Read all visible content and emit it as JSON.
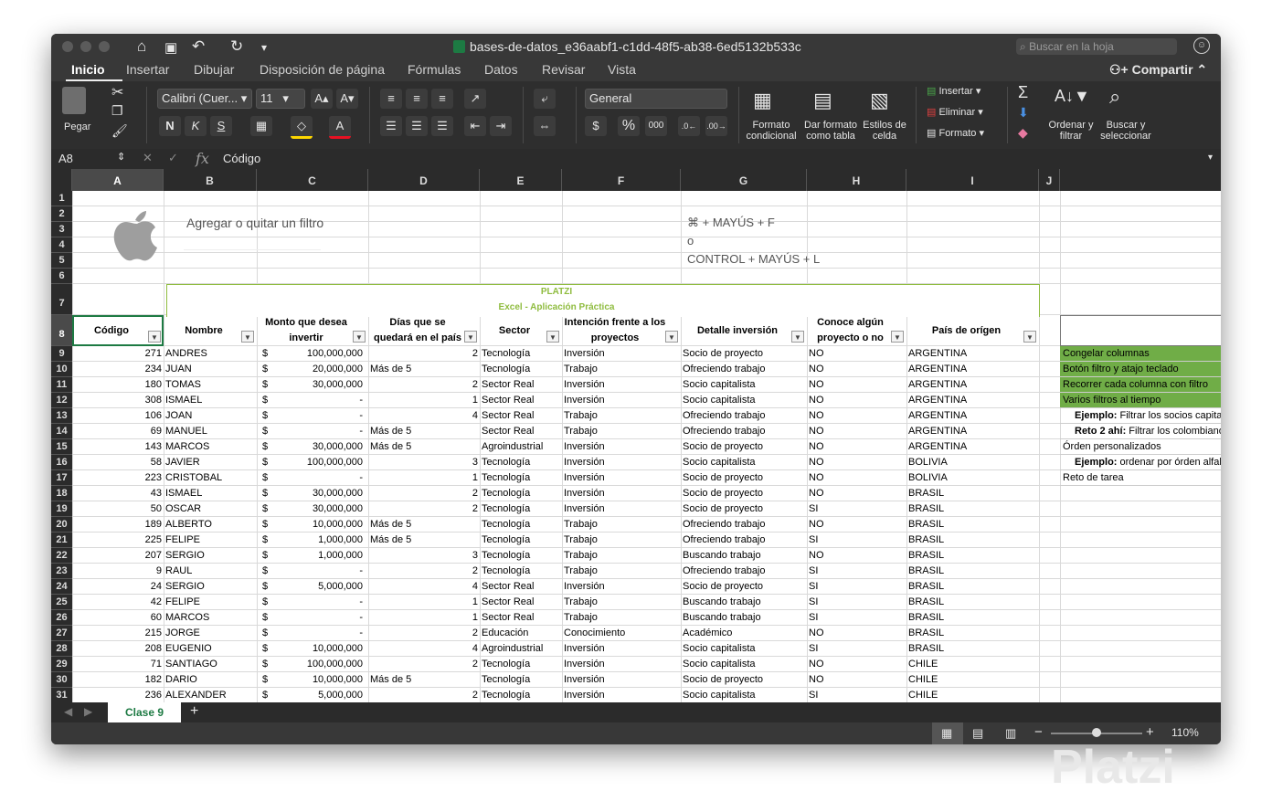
{
  "window": {
    "title": "bases-de-datos_e36aabf1-c1dd-48f5-ab38-6ed5132b533c",
    "search_placeholder": "Buscar en la hoja",
    "share_label": "Compartir"
  },
  "tabs": [
    "Inicio",
    "Insertar",
    "Dibujar",
    "Disposición de página",
    "Fórmulas",
    "Datos",
    "Revisar",
    "Vista"
  ],
  "ribbon": {
    "paste_label": "Pegar",
    "font_name": "Calibri (Cuer...",
    "font_size": "11",
    "number_format": "General",
    "cond_format_label": "Formato condicional",
    "table_format_label": "Dar formato como tabla",
    "cell_styles_label": "Estilos de celda",
    "insert_label": "Insertar",
    "delete_label": "Eliminar",
    "format_label": "Formato",
    "sort_filter_label": "Ordenar y filtrar",
    "find_select_label": "Buscar y seleccionar"
  },
  "formula_bar": {
    "name_box": "A8",
    "fx": "fx",
    "value": "Código"
  },
  "columns": [
    "A",
    "B",
    "C",
    "D",
    "E",
    "F",
    "G",
    "H",
    "I",
    "J"
  ],
  "info_panel": {
    "text": "Agregar o quitar un filtro",
    "shortcut_mac": "⌘ + MAYÚS + F",
    "or": "o",
    "shortcut_win": "CONTROL + MAYÚS + L"
  },
  "banner": {
    "line1": "PLATZI",
    "line2": "Excel - Aplicación Práctica"
  },
  "headers": [
    "Código",
    "Nombre",
    "Monto que desea invertir",
    "Días que se quedará en el país",
    "Sector",
    "Intención frente a los proyectos",
    "Detalle inversión",
    "Conoce algún proyecto o no",
    "País de orígen"
  ],
  "rows": [
    {
      "n": "9",
      "codigo": "271",
      "nombre": "ANDRES",
      "cur": "$",
      "monto": "100,000,000",
      "dias": "2",
      "sector": "Tecnología",
      "intencion": "Inversión",
      "detalle": "Socio de proyecto",
      "conoce": "NO",
      "pais": "ARGENTINA"
    },
    {
      "n": "10",
      "codigo": "234",
      "nombre": "JUAN",
      "cur": "$",
      "monto": "20,000,000",
      "dias": "Más de 5",
      "sector": "Tecnología",
      "intencion": "Trabajo",
      "detalle": "Ofreciendo trabajo",
      "conoce": "NO",
      "pais": "ARGENTINA"
    },
    {
      "n": "11",
      "codigo": "180",
      "nombre": "TOMAS",
      "cur": "$",
      "monto": "30,000,000",
      "dias": "2",
      "sector": "Sector Real",
      "intencion": "Inversión",
      "detalle": "Socio capitalista",
      "conoce": "NO",
      "pais": "ARGENTINA"
    },
    {
      "n": "12",
      "codigo": "308",
      "nombre": "ISMAEL",
      "cur": "$",
      "monto": "-",
      "dias": "1",
      "sector": "Sector Real",
      "intencion": "Inversión",
      "detalle": "Socio capitalista",
      "conoce": "NO",
      "pais": "ARGENTINA"
    },
    {
      "n": "13",
      "codigo": "106",
      "nombre": "JOAN",
      "cur": "$",
      "monto": "-",
      "dias": "4",
      "sector": "Sector Real",
      "intencion": "Trabajo",
      "detalle": "Ofreciendo trabajo",
      "conoce": "NO",
      "pais": "ARGENTINA"
    },
    {
      "n": "14",
      "codigo": "69",
      "nombre": "MANUEL",
      "cur": "$",
      "monto": "-",
      "dias": "Más de 5",
      "sector": "Sector Real",
      "intencion": "Trabajo",
      "detalle": "Ofreciendo trabajo",
      "conoce": "NO",
      "pais": "ARGENTINA"
    },
    {
      "n": "15",
      "codigo": "143",
      "nombre": "MARCOS",
      "cur": "$",
      "monto": "30,000,000",
      "dias": "Más de 5",
      "sector": "Agroindustrial",
      "intencion": "Inversión",
      "detalle": "Socio de proyecto",
      "conoce": "NO",
      "pais": "ARGENTINA"
    },
    {
      "n": "16",
      "codigo": "58",
      "nombre": "JAVIER",
      "cur": "$",
      "monto": "100,000,000",
      "dias": "3",
      "sector": "Tecnología",
      "intencion": "Inversión",
      "detalle": "Socio capitalista",
      "conoce": "NO",
      "pais": "BOLIVIA"
    },
    {
      "n": "17",
      "codigo": "223",
      "nombre": "CRISTOBAL",
      "cur": "$",
      "monto": "-",
      "dias": "1",
      "sector": "Tecnología",
      "intencion": "Inversión",
      "detalle": "Socio de proyecto",
      "conoce": "NO",
      "pais": "BOLIVIA"
    },
    {
      "n": "18",
      "codigo": "43",
      "nombre": "ISMAEL",
      "cur": "$",
      "monto": "30,000,000",
      "dias": "2",
      "sector": "Tecnología",
      "intencion": "Inversión",
      "detalle": "Socio de proyecto",
      "conoce": "NO",
      "pais": "BRASIL"
    },
    {
      "n": "19",
      "codigo": "50",
      "nombre": "OSCAR",
      "cur": "$",
      "monto": "30,000,000",
      "dias": "2",
      "sector": "Tecnología",
      "intencion": "Inversión",
      "detalle": "Socio de proyecto",
      "conoce": "SI",
      "pais": "BRASIL"
    },
    {
      "n": "20",
      "codigo": "189",
      "nombre": "ALBERTO",
      "cur": "$",
      "monto": "10,000,000",
      "dias": "Más de 5",
      "sector": "Tecnología",
      "intencion": "Trabajo",
      "detalle": "Ofreciendo trabajo",
      "conoce": "NO",
      "pais": "BRASIL"
    },
    {
      "n": "21",
      "codigo": "225",
      "nombre": "FELIPE",
      "cur": "$",
      "monto": "1,000,000",
      "dias": "Más de 5",
      "sector": "Tecnología",
      "intencion": "Trabajo",
      "detalle": "Ofreciendo trabajo",
      "conoce": "SI",
      "pais": "BRASIL"
    },
    {
      "n": "22",
      "codigo": "207",
      "nombre": "SERGIO",
      "cur": "$",
      "monto": "1,000,000",
      "dias": "3",
      "sector": "Tecnología",
      "intencion": "Trabajo",
      "detalle": "Buscando trabajo",
      "conoce": "NO",
      "pais": "BRASIL"
    },
    {
      "n": "23",
      "codigo": "9",
      "nombre": "RAUL",
      "cur": "$",
      "monto": "-",
      "dias": "2",
      "sector": "Tecnología",
      "intencion": "Trabajo",
      "detalle": "Ofreciendo trabajo",
      "conoce": "SI",
      "pais": "BRASIL"
    },
    {
      "n": "24",
      "codigo": "24",
      "nombre": "SERGIO",
      "cur": "$",
      "monto": "5,000,000",
      "dias": "4",
      "sector": "Sector Real",
      "intencion": "Inversión",
      "detalle": "Socio de proyecto",
      "conoce": "SI",
      "pais": "BRASIL"
    },
    {
      "n": "25",
      "codigo": "42",
      "nombre": "FELIPE",
      "cur": "$",
      "monto": "-",
      "dias": "1",
      "sector": "Sector Real",
      "intencion": "Trabajo",
      "detalle": "Buscando trabajo",
      "conoce": "SI",
      "pais": "BRASIL"
    },
    {
      "n": "26",
      "codigo": "60",
      "nombre": "MARCOS",
      "cur": "$",
      "monto": "-",
      "dias": "1",
      "sector": "Sector Real",
      "intencion": "Trabajo",
      "detalle": "Buscando trabajo",
      "conoce": "SI",
      "pais": "BRASIL"
    },
    {
      "n": "27",
      "codigo": "215",
      "nombre": "JORGE",
      "cur": "$",
      "monto": "-",
      "dias": "2",
      "sector": "Educación",
      "intencion": "Conocimiento",
      "detalle": "Académico",
      "conoce": "NO",
      "pais": "BRASIL"
    },
    {
      "n": "28",
      "codigo": "208",
      "nombre": "EUGENIO",
      "cur": "$",
      "monto": "10,000,000",
      "dias": "4",
      "sector": "Agroindustrial",
      "intencion": "Inversión",
      "detalle": "Socio capitalista",
      "conoce": "SI",
      "pais": "BRASIL"
    },
    {
      "n": "29",
      "codigo": "71",
      "nombre": "SANTIAGO",
      "cur": "$",
      "monto": "100,000,000",
      "dias": "2",
      "sector": "Tecnología",
      "intencion": "Inversión",
      "detalle": "Socio capitalista",
      "conoce": "NO",
      "pais": "CHILE"
    },
    {
      "n": "30",
      "codigo": "182",
      "nombre": "DARIO",
      "cur": "$",
      "monto": "10,000,000",
      "dias": "Más de 5",
      "sector": "Tecnología",
      "intencion": "Inversión",
      "detalle": "Socio de proyecto",
      "conoce": "NO",
      "pais": "CHILE"
    },
    {
      "n": "31",
      "codigo": "236",
      "nombre": "ALEXANDER",
      "cur": "$",
      "monto": "5,000,000",
      "dias": "2",
      "sector": "Tecnología",
      "intencion": "Inversión",
      "detalle": "Socio capitalista",
      "conoce": "SI",
      "pais": "CHILE"
    }
  ],
  "side_notes": [
    {
      "text": "Congelar columnas",
      "green": true
    },
    {
      "text": "Botón filtro y atajo teclado",
      "green": true
    },
    {
      "text": "Recorrer cada columna con filtro",
      "green": true
    },
    {
      "text": "Varios filtros al tiempo",
      "green": true
    },
    {
      "bold": "Ejemplo:",
      "text": " Filtrar los socios capitalistas",
      "green": false,
      "indent": true
    },
    {
      "bold": "Reto 2 ahí:",
      "text": " Filtrar los colombianos",
      "green": false,
      "indent": true
    },
    {
      "text": "Órden personalizados",
      "green": false
    },
    {
      "bold": "Ejemplo:",
      "text": " ordenar por órden alfabético",
      "green": false,
      "indent": true
    },
    {
      "text": "Reto de tarea",
      "green": false
    }
  ],
  "sheet_tab": "Clase 9",
  "zoom": "110%",
  "watermark": "Platzi",
  "colors": {
    "accent_green": "#70ad47",
    "tab_green": "#1d7a43",
    "banner_green": "#8fbc3f"
  }
}
